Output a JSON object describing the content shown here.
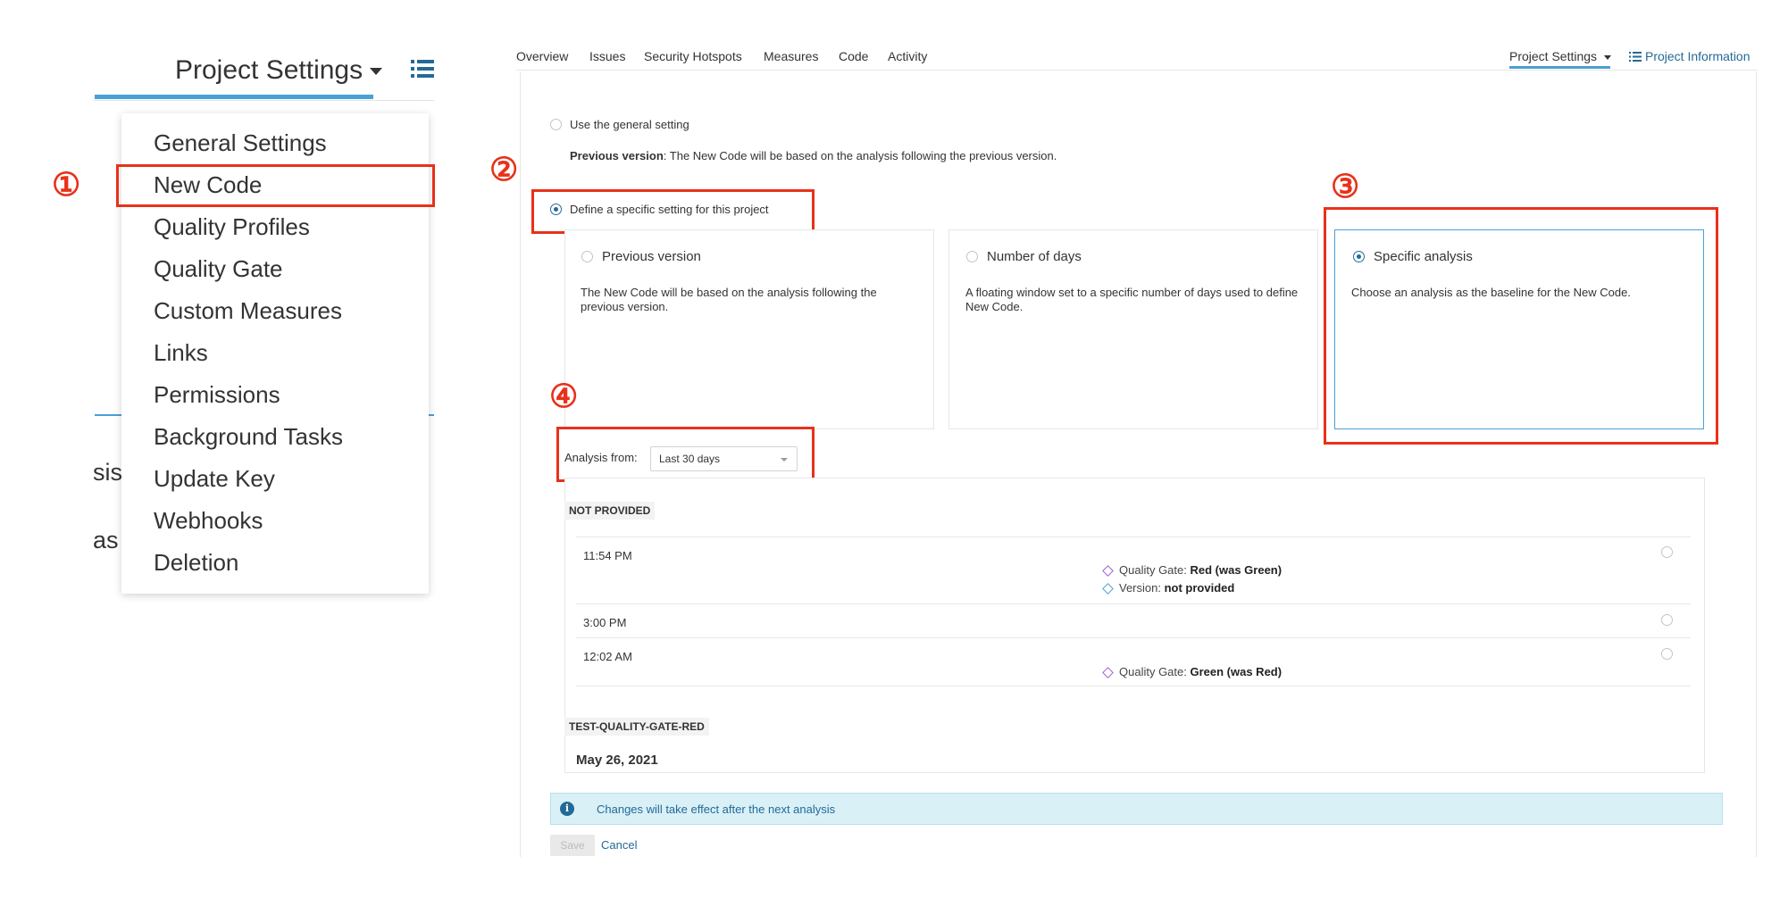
{
  "left_panel": {
    "title": "Project Settings",
    "menu": {
      "items": [
        {
          "label": "General Settings",
          "name": "menu-item-general-settings"
        },
        {
          "label": "New Code",
          "name": "menu-item-new-code"
        },
        {
          "label": "Quality Profiles",
          "name": "menu-item-quality-profiles"
        },
        {
          "label": "Quality Gate",
          "name": "menu-item-quality-gate"
        },
        {
          "label": "Custom Measures",
          "name": "menu-item-custom-measures"
        },
        {
          "label": "Links",
          "name": "menu-item-links"
        },
        {
          "label": "Permissions",
          "name": "menu-item-permissions"
        },
        {
          "label": "Background Tasks",
          "name": "menu-item-background-tasks"
        },
        {
          "label": "Update Key",
          "name": "menu-item-update-key"
        },
        {
          "label": "Webhooks",
          "name": "menu-item-webhooks"
        },
        {
          "label": "Deletion",
          "name": "menu-item-deletion"
        }
      ]
    },
    "partial_text": [
      "sis",
      "as"
    ]
  },
  "steps": {
    "s1": "①",
    "s2": "②",
    "s3": "③",
    "s4": "④"
  },
  "nav": {
    "tabs": [
      "Overview",
      "Issues",
      "Security Hotspots",
      "Measures",
      "Code",
      "Activity"
    ],
    "project_settings": "Project Settings",
    "project_information": "Project Information"
  },
  "general": {
    "label": "Use the general setting",
    "desc_bold": "Previous version",
    "desc_rest": ": The New Code will be based on the analysis following the previous version."
  },
  "specific": {
    "label": "Define a specific setting for this project"
  },
  "options": [
    {
      "title": "Previous version",
      "desc": "The New Code will be based on the analysis following the previous version."
    },
    {
      "title": "Number of days",
      "desc": "A floating window set to a specific number of days used to define New Code."
    },
    {
      "title": "Specific analysis",
      "desc": "Choose an analysis as the baseline for the New Code."
    }
  ],
  "analysis_from": {
    "label": "Analysis from:",
    "value": "Last 30 days"
  },
  "groups": [
    {
      "tag": "NOT PROVIDED",
      "rows": [
        {
          "time": "11:54 PM",
          "events": [
            {
              "prefix": "Quality Gate: ",
              "value": "Red (was Green)",
              "color": "#a55cd6"
            },
            {
              "prefix": "Version: ",
              "value": "not provided",
              "color": "#4b9fd5"
            }
          ]
        },
        {
          "time": "3:00 PM",
          "events": []
        },
        {
          "time": "12:02 AM",
          "events": [
            {
              "prefix": "Quality Gate: ",
              "value": "Green (was Red)",
              "color": "#a55cd6"
            }
          ]
        }
      ]
    },
    {
      "tag": "TEST-QUALITY-GATE-RED",
      "date": "May 26, 2021"
    }
  ],
  "info_message": "Changes will take effect after the next analysis",
  "buttons": {
    "save": "Save",
    "cancel": "Cancel"
  },
  "colors": {
    "accent": "#4b9fd5",
    "highlight": "#e8311a",
    "link": "#236a97",
    "info_bg": "#d9f0f7"
  }
}
